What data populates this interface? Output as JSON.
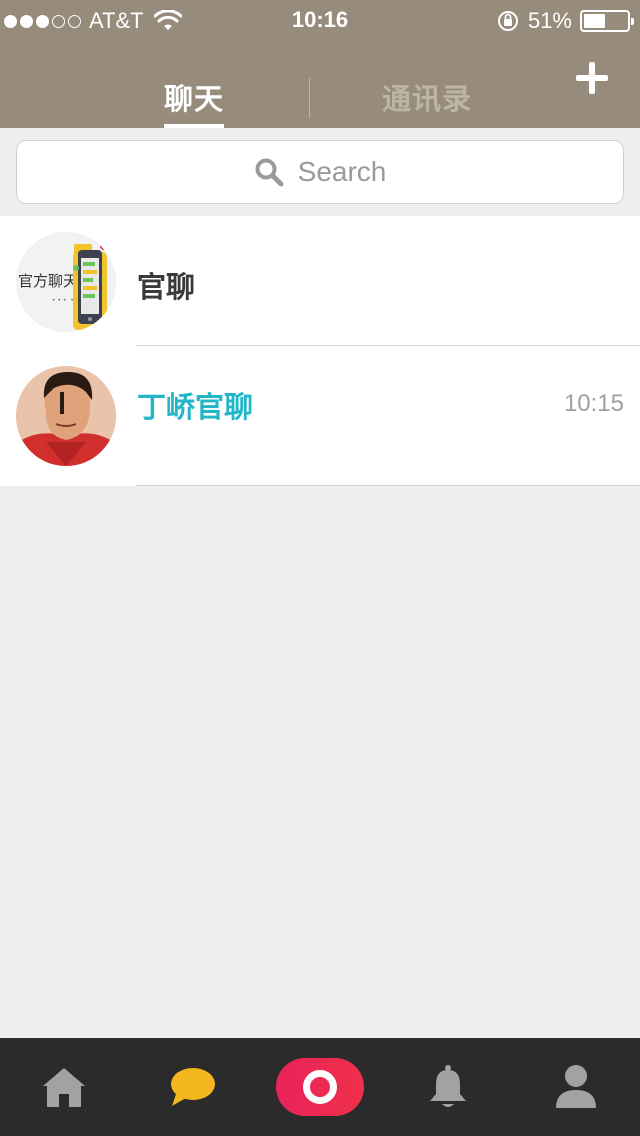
{
  "status_bar": {
    "carrier": "AT&T",
    "time": "10:16",
    "battery_percent": "51%",
    "battery_level": 0.51,
    "signal_bars_filled": 3,
    "signal_bars_total": 5
  },
  "nav": {
    "tabs": [
      {
        "label": "聊天",
        "active": true
      },
      {
        "label": "通讯录",
        "active": false
      }
    ],
    "add_icon": "plus-icon"
  },
  "search": {
    "placeholder": "Search",
    "icon": "search-icon"
  },
  "chats": [
    {
      "name": "官聊",
      "time": "",
      "avatar": "official-chat-avatar"
    },
    {
      "name": "丁峤官聊",
      "time": "10:15",
      "avatar": "user-avatar"
    }
  ],
  "avatar_text": {
    "official": "官方聊天"
  },
  "tab_bar": {
    "items": [
      "home-icon",
      "message-bubble-icon",
      "camera-icon",
      "bell-icon",
      "person-icon"
    ]
  },
  "colors": {
    "header": "#978c7b",
    "active_tab": "#ffffff",
    "inactive_tab": "#bdb4a5",
    "highlight_name": "#22b6c8",
    "tab_bar_bg": "#2b2b2b",
    "message_icon": "#f4b81e",
    "camera_button": "#e8235a"
  }
}
